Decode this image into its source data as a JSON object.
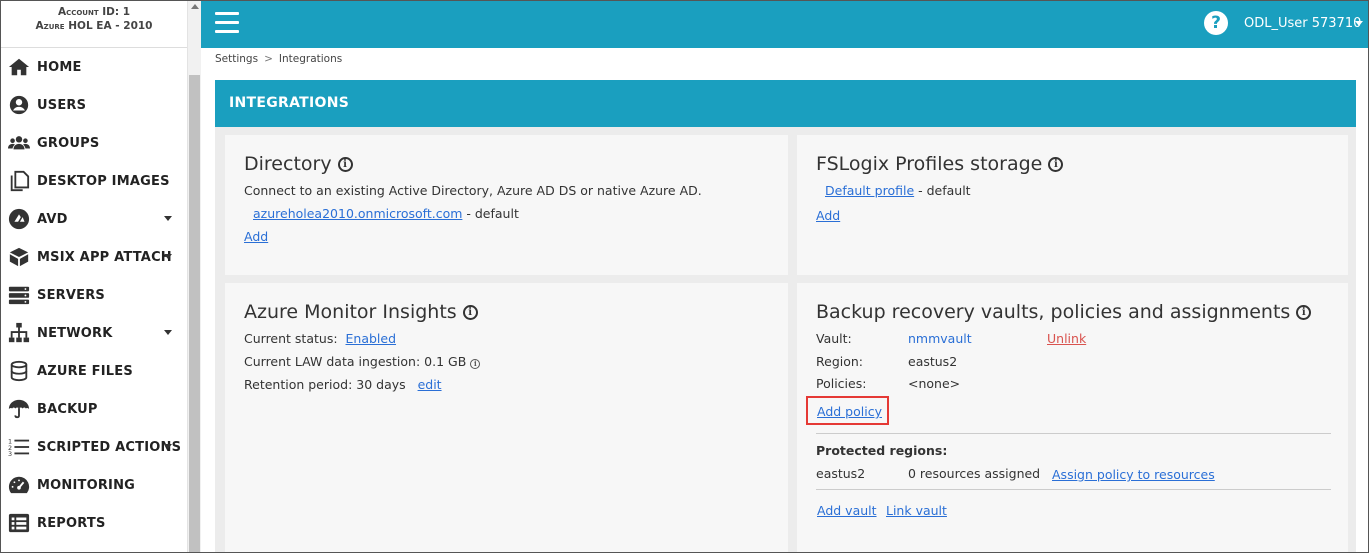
{
  "account": {
    "line1": "Account ID: 1",
    "line2": "Azure HOL EA - 2010"
  },
  "sidebar": {
    "items": [
      {
        "label": "HOME",
        "icon": "home-icon",
        "caret": false
      },
      {
        "label": "USERS",
        "icon": "user-icon",
        "caret": false
      },
      {
        "label": "GROUPS",
        "icon": "groups-icon",
        "caret": false
      },
      {
        "label": "DESKTOP IMAGES",
        "icon": "copy-icon",
        "caret": false
      },
      {
        "label": "AVD",
        "icon": "avd-icon",
        "caret": true
      },
      {
        "label": "MSIX APP ATTACH",
        "icon": "box-icon",
        "caret": true
      },
      {
        "label": "SERVERS",
        "icon": "servers-icon",
        "caret": false
      },
      {
        "label": "NETWORK",
        "icon": "network-icon",
        "caret": true
      },
      {
        "label": "AZURE FILES",
        "icon": "database-icon",
        "caret": false
      },
      {
        "label": "BACKUP",
        "icon": "umbrella-icon",
        "caret": false
      },
      {
        "label": "SCRIPTED ACTIONS",
        "icon": "list-ol-icon",
        "caret": true
      },
      {
        "label": "MONITORING",
        "icon": "gauge-icon",
        "caret": false
      },
      {
        "label": "REPORTS",
        "icon": "report-icon",
        "caret": false
      }
    ]
  },
  "topbar": {
    "help": "?",
    "user": "ODL_User 573710"
  },
  "breadcrumb": {
    "settings": "Settings",
    "sep": ">",
    "current": "Integrations"
  },
  "page": {
    "heading": "INTEGRATIONS"
  },
  "directory": {
    "title": "Directory",
    "desc": "Connect to an existing Active Directory, Azure AD DS or native Azure AD.",
    "domain": "azureholea2010.onmicrosoft.com",
    "domain_suffix": " - default",
    "add": "Add"
  },
  "fslogix": {
    "title": "FSLogix Profiles storage",
    "profile": "Default profile",
    "profile_suffix": " - default",
    "add": "Add"
  },
  "monitor": {
    "title": "Azure Monitor Insights",
    "status_label": "Current status:",
    "status_value": "Enabled",
    "ingestion": "Current LAW data ingestion: 0.1 GB",
    "retention": "Retention period: 30 days",
    "edit": "edit"
  },
  "backup": {
    "title": "Backup recovery vaults, policies and assignments",
    "vault_label": "Vault:",
    "vault_value": "nmmvault",
    "unlink": "Unlink",
    "region_label": "Region:",
    "region_value": "eastus2",
    "policies_label": "Policies:",
    "policies_value": "<none>",
    "add_policy": "Add policy",
    "protected_title": "Protected regions:",
    "protected_region": "eastus2",
    "resources": "0 resources assigned",
    "assign": "Assign policy to resources",
    "add_vault": "Add vault",
    "link_vault": "Link vault"
  },
  "colors": {
    "accent": "#1a9fbf",
    "link": "#2a6fd6",
    "danger": "#d9534f",
    "highlight": "#e53935"
  }
}
